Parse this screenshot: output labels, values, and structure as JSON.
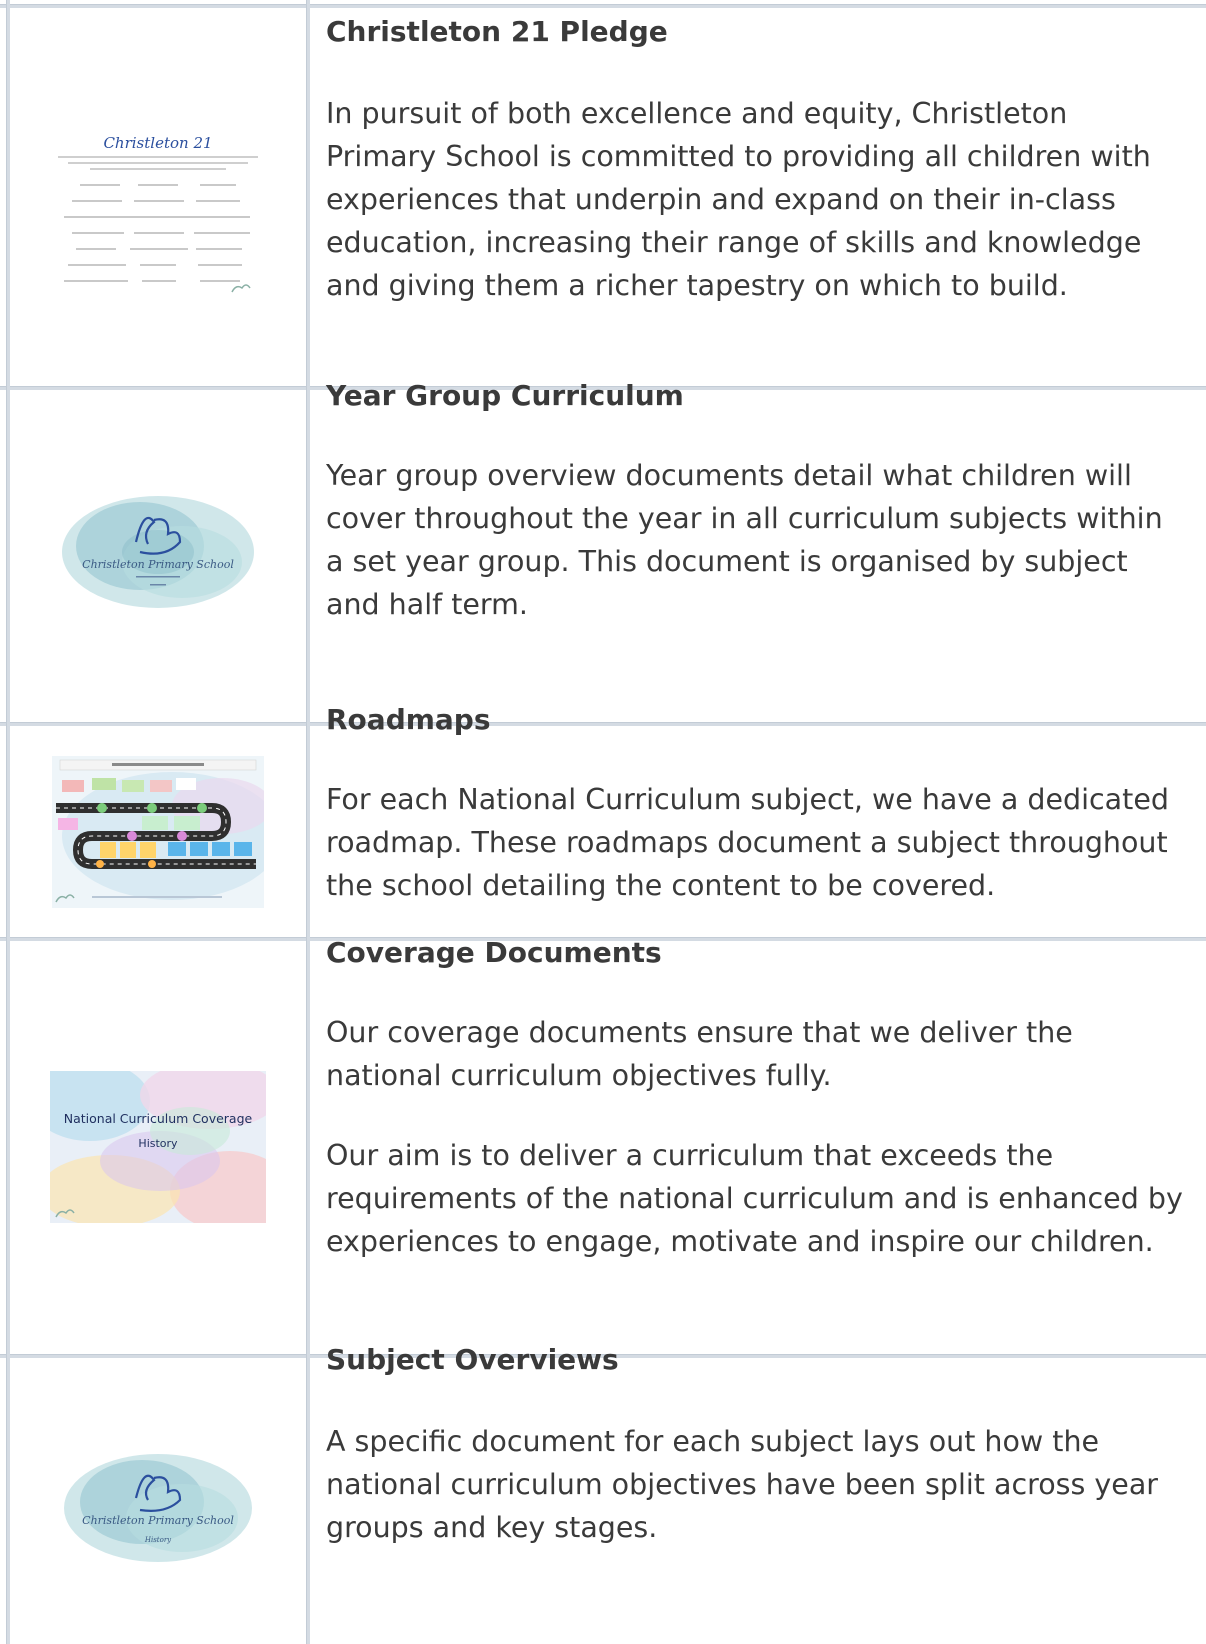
{
  "rows": [
    {
      "title": "Christleton 21 Pledge",
      "paragraphs": [
        "In pursuit of both excellence and equity, Christleton Primary School is committed to providing all children with experiences that underpin and expand on their in-class education, increasing their range of skills and knowledge and giving them a richer tapestry on which to build."
      ],
      "thumb_title": "Christleton 21"
    },
    {
      "title": "Year Group Curriculum",
      "paragraphs": [
        "Year group overview documents detail what children will cover throughout the year in all curriculum subjects within a set year group. This document is organised by subject and half term."
      ],
      "thumb_title": "Christleton Primary School"
    },
    {
      "title": "Roadmaps",
      "paragraphs": [
        "For each National Curriculum subject, we have a dedicated roadmap. These roadmaps document a subject throughout the school detailing the content to be covered."
      ]
    },
    {
      "title": "Coverage Documents",
      "paragraphs": [
        "Our coverage documents ensure that we deliver the national curriculum objectives fully.",
        "Our aim is to deliver a curriculum that exceeds the requirements of the national curriculum and is enhanced by experiences to engage, motivate and inspire our children."
      ],
      "thumb_title": "National Curriculum Coverage",
      "thumb_subtitle": "History"
    },
    {
      "title": "Subject Overviews",
      "paragraphs": [
        "A specific document for each subject lays out how the national curriculum objectives have been split across year groups and key stages."
      ],
      "thumb_title": "Christleton Primary School",
      "thumb_subtitle": "History"
    }
  ],
  "colors": {
    "border": "#d4dbe3",
    "text": "#3a3a3a",
    "accent_blue": "#2b4f9e"
  }
}
